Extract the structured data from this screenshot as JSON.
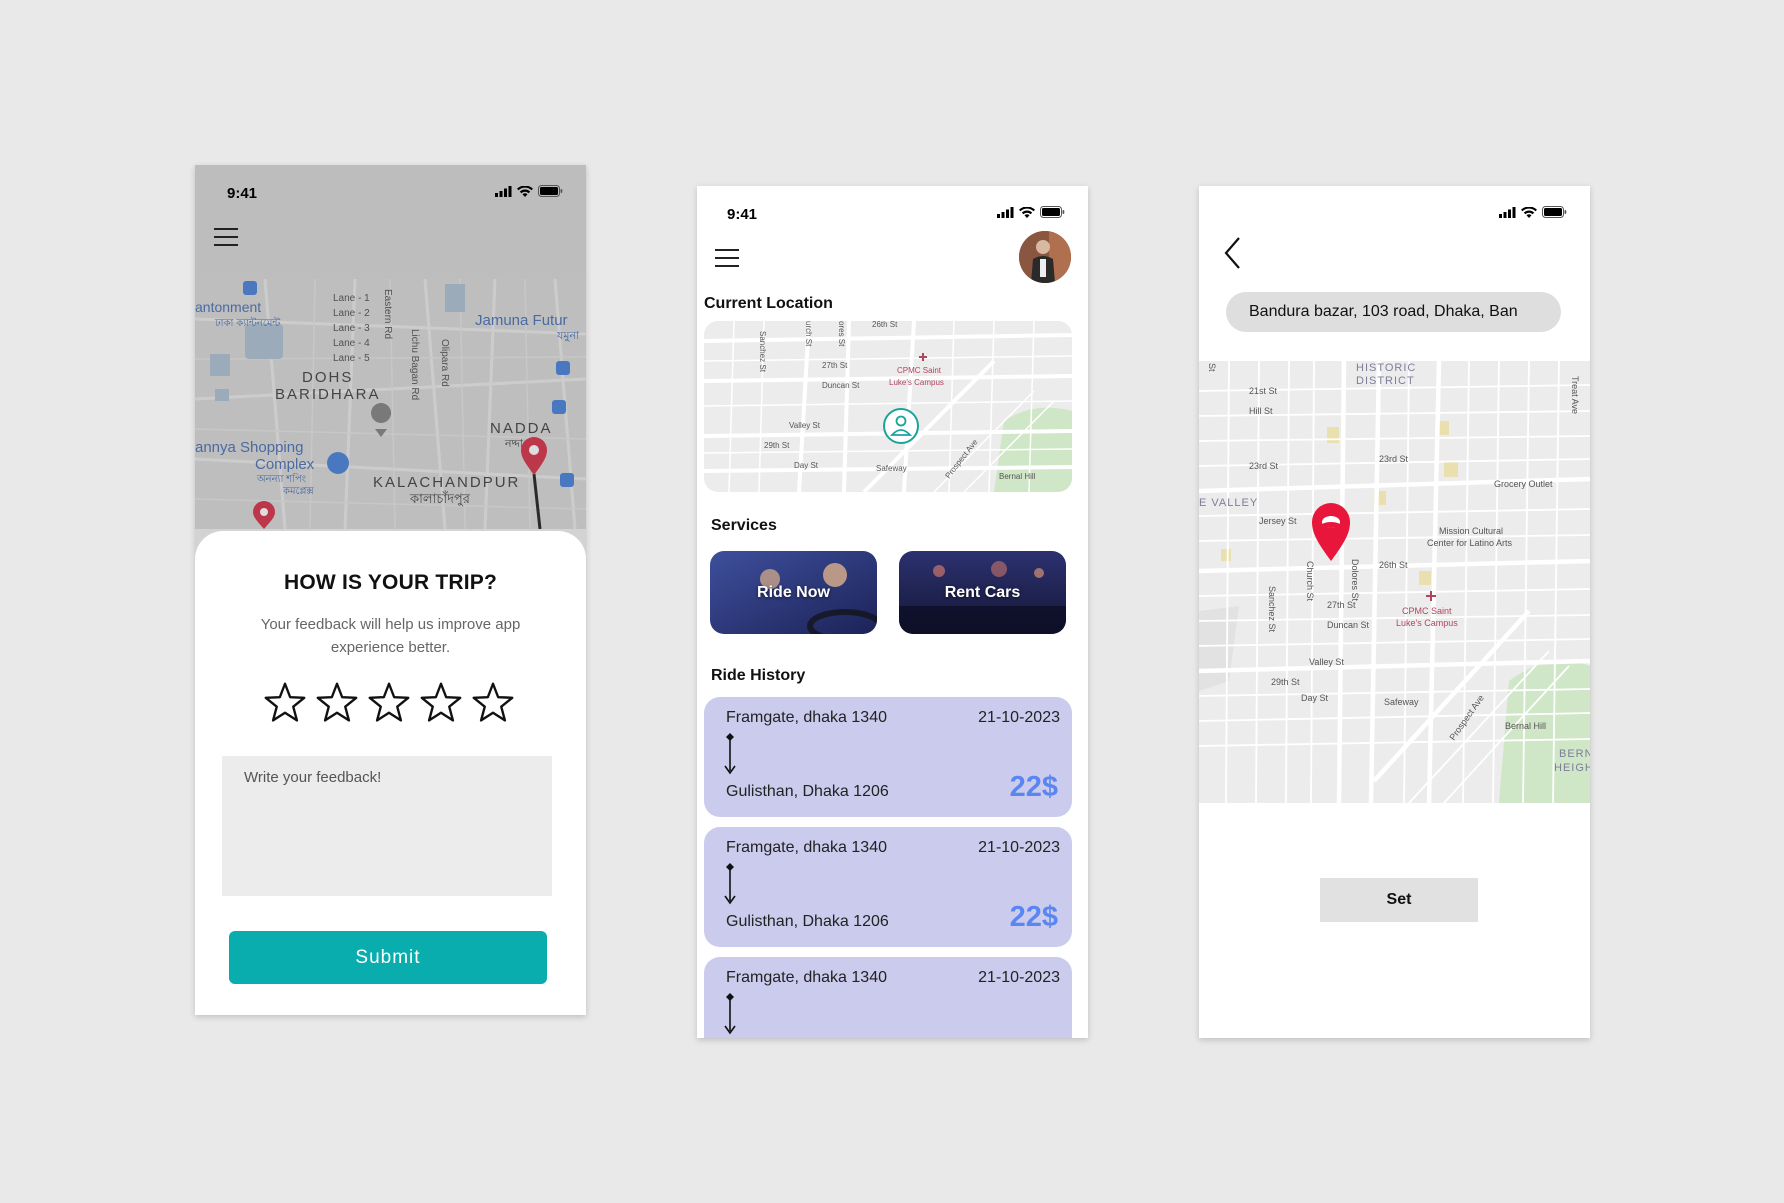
{
  "colors": {
    "page_background": "#e9e9e9",
    "teal_accent": "#0aadad",
    "ride_card": "#cbcbee",
    "price_blue": "#5a86f1",
    "pin_red": "#e8163a"
  },
  "status_bar": {
    "time": "9:41",
    "icons": [
      "signal-icon",
      "wifi-icon",
      "battery-icon"
    ]
  },
  "feedback_screen": {
    "map_labels": {
      "cantonment": "antonment",
      "cantonment_bn": "ঢাকা\nক্যান্টনমেন্ট",
      "lane1": "Lane - 1",
      "lane2": "Lane - 2",
      "lane3": "Lane - 3",
      "lane4": "Lane - 4",
      "lane5": "Lane - 5",
      "eastern_rd": "Eastern Rd",
      "lichu_bagan": "Lichu Bagan Rd",
      "olipara": "Olipara Rd",
      "jamuna": "Jamuna Futur",
      "jamuna_bn": "যমুনা",
      "dohs": "DOHS",
      "baridhara": "BARIDHARA",
      "nadda": "NADDA",
      "nadda_bn": "নদ্দা",
      "shopping": "annya Shopping",
      "complex": "Complex",
      "shopping_bn1": "অনন্যা শপিং",
      "shopping_bn2": "কমপ্লেক্স",
      "kalachandpur": "KALACHANDPUR",
      "kalachandpur_bn": "কালাচাঁদপুর"
    },
    "title": "HOW IS YOUR TRIP?",
    "subtitle": "Your feedback will help us improve app experience better.",
    "rating": {
      "value": 0,
      "max": 5
    },
    "feedback_placeholder": "Write your feedback!",
    "feedback_value": "",
    "submit_label": "Submit"
  },
  "home_screen": {
    "current_location_title": "Current Location",
    "map_labels": {
      "sanchez": "Sanchez St",
      "church": "urch St",
      "dolores": "ores St",
      "st26": "26th St",
      "st27": "27th St",
      "duncan": "Duncan St",
      "valley": "Valley St",
      "st29": "29th St",
      "day": "Day St",
      "safeway": "Safeway",
      "prospect": "Prospect Ave",
      "bernal": "Bernal Hill",
      "cpmc1": "CPMC Saint",
      "cpmc2": "Luke's Campus"
    },
    "services_title": "Services",
    "services": [
      {
        "label": "Ride Now"
      },
      {
        "label": "Rent Cars"
      }
    ],
    "ride_history_title": "Ride History",
    "rides": [
      {
        "from": "Framgate, dhaka 1340",
        "date": "21-10-2023",
        "to": "Gulisthan, Dhaka 1206",
        "price": "22$"
      },
      {
        "from": "Framgate, dhaka 1340",
        "date": "21-10-2023",
        "to": "Gulisthan, Dhaka 1206",
        "price": "22$"
      },
      {
        "from": "Framgate, dhaka 1340",
        "date": "21-10-2023",
        "to": "",
        "price": ""
      }
    ]
  },
  "location_screen": {
    "address": "Bandura bazar, 103 road, Dhaka, Ban",
    "map_labels": {
      "historic1": "HISTORIC",
      "historic2": "DISTRICT",
      "st21": "21st St",
      "hill": "Hill St",
      "st23a": "23rd St",
      "st23b": "23rd St",
      "grocery": "Grocery Outlet",
      "evalley": "E VALLEY",
      "jersey": "Jersey St",
      "mission1": "Mission Cultural",
      "mission2": "Center for Latino Arts",
      "church": "Church St",
      "dolores": "Dolores St",
      "st26": "26th St",
      "sanchez": "Sanchez St",
      "st27": "27th St",
      "cpmc1": "CPMC Saint",
      "cpmc2": "Luke's Campus",
      "duncan": "Duncan St",
      "valley": "Valley St",
      "st29": "29th St",
      "day": "Day St",
      "safeway": "Safeway",
      "prospect": "Prospect Ave",
      "bernal_hill": "Bernal Hill",
      "bernal_h1": "BERNAL",
      "bernal_h2": "HEIGHTS",
      "treat": "Treat Ave",
      "st_short": "St"
    },
    "set_label": "Set"
  }
}
